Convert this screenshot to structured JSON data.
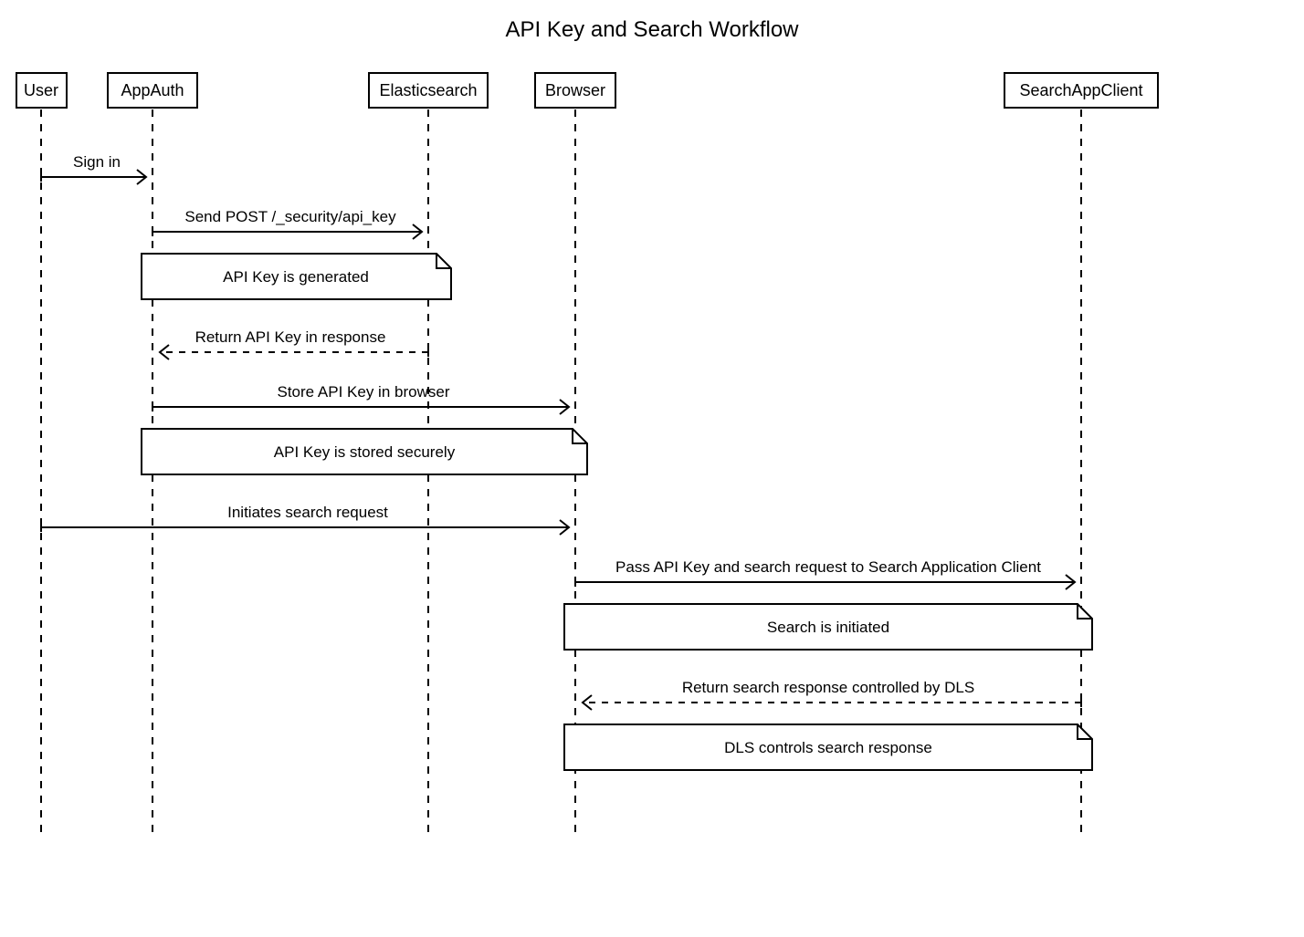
{
  "title": "API Key and Search Workflow",
  "actors": {
    "user": "User",
    "appauth": "AppAuth",
    "elastic": "Elasticsearch",
    "browser": "Browser",
    "searchclient": "SearchAppClient"
  },
  "messages": {
    "m1": "Sign in",
    "m2": "Send POST /_security/api_key",
    "m3": "Return API Key in response",
    "m4": "Store API Key in browser",
    "m5": "Initiates search request",
    "m6": "Pass API Key and search request to Search Application Client",
    "m7": "Return search response controlled by DLS"
  },
  "notes": {
    "n1": "API Key is generated",
    "n2": "API Key is stored securely",
    "n3": "Search is initiated",
    "n4": "DLS controls search response"
  }
}
